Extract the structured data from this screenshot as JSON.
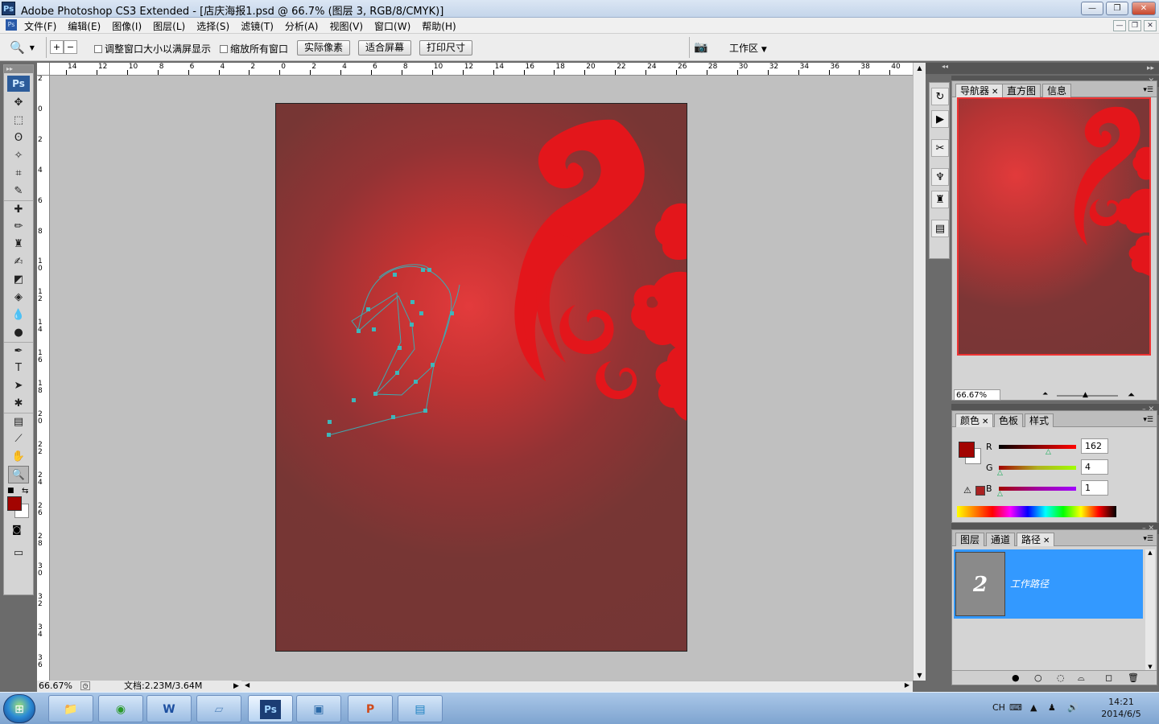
{
  "window": {
    "title": "Adobe Photoshop CS3 Extended - [店庆海报1.psd @ 66.7% (图层 3, RGB/8/CMYK)]",
    "app_badge": "Ps",
    "controls": [
      "minimize-icon",
      "restore-icon",
      "close-icon"
    ]
  },
  "menu": {
    "items": [
      "文件(F)",
      "编辑(E)",
      "图像(I)",
      "图层(L)",
      "选择(S)",
      "滤镜(T)",
      "分析(A)",
      "视图(V)",
      "窗口(W)",
      "帮助(H)"
    ]
  },
  "options": {
    "tool_icon": "zoom-icon",
    "checkbox_resize": "调整窗口大小以满屏显示",
    "checkbox_zoom_all": "缩放所有窗口",
    "btn_actual": "实际像素",
    "btn_fit": "适合屏幕",
    "btn_print": "打印尺寸",
    "workspace_label": "工作区"
  },
  "toolbox": {
    "badge": "Ps",
    "foreground_color": "#a20401",
    "background_color": "#ffffff"
  },
  "rulers": {
    "top": [
      "14",
      "12",
      "10",
      "8",
      "6",
      "4",
      "2",
      "0",
      "2",
      "4",
      "6",
      "8",
      "10",
      "12",
      "14",
      "16",
      "18",
      "20",
      "22",
      "24",
      "26",
      "28",
      "30",
      "32",
      "34",
      "36",
      "38",
      "40"
    ],
    "left": [
      "2",
      "0",
      "2",
      "4",
      "6",
      "8",
      "10",
      "12",
      "14",
      "16",
      "18",
      "20",
      "22",
      "24",
      "26",
      "28",
      "30",
      "32",
      "34",
      "36"
    ]
  },
  "status": {
    "zoom": "66.67%",
    "doc_info": "文档:2.23M/3.64M"
  },
  "navigator": {
    "tabs": [
      "导航器",
      "直方图",
      "信息"
    ],
    "active_tab": "导航器",
    "zoom": "66.67%"
  },
  "color_panel": {
    "tabs": [
      "颜色",
      "色板",
      "样式"
    ],
    "active_tab": "颜色",
    "swatch": "#a20401",
    "channels": [
      {
        "label": "R",
        "value": "162"
      },
      {
        "label": "G",
        "value": "4"
      },
      {
        "label": "B",
        "value": "1"
      }
    ]
  },
  "paths_panel": {
    "tabs": [
      "图层",
      "通道",
      "路径"
    ],
    "active_tab": "路径",
    "path_name": "工作路径",
    "thumb_glyph": "2"
  },
  "taskbar": {
    "apps": [
      "explorer-icon",
      "browser-icon",
      "word-icon",
      "notepad-icon",
      "photoshop-icon",
      "photo-viewer-icon",
      "powerpoint-icon",
      "app-icon"
    ],
    "photoshop_label": "Ps",
    "word_label": "W",
    "powerpoint_label": "P",
    "lang": "CH",
    "time": "14:21",
    "date": "2014/6/5"
  }
}
